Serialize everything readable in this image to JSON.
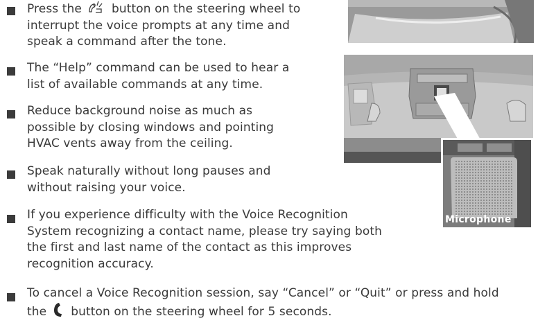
{
  "bullets": [
    {
      "lines": [
        "Press the",
        "button on the steering wheel to",
        "interrupt the voice prompts at any time and",
        "speak a command after the tone."
      ]
    },
    {
      "lines": [
        "The “Help” command can be used to hear a",
        "list of available commands at any time."
      ]
    },
    {
      "lines": [
        "Reduce background noise as much as",
        "possible by closing windows and pointing",
        "HVAC vents away from the ceiling."
      ]
    },
    {
      "lines": [
        "Speak naturally without long pauses and",
        "without raising your voice."
      ]
    },
    {
      "lines": [
        "If you experience difficulty with the Voice Recognition",
        "System recognizing a contact name, please try saying both",
        "the first and last name of the contact as this improves",
        "recognition accuracy."
      ]
    },
    {
      "lines": [
        "To cancel a Voice Recognition session, say “Cancel” or “Quit” or press and hold",
        "the",
        "button on the steering wheel for 5 seconds."
      ]
    }
  ],
  "figure": {
    "microphone_label": "Microphone"
  },
  "icons": [
    "talk-button-icon",
    "phone-button-icon"
  ]
}
